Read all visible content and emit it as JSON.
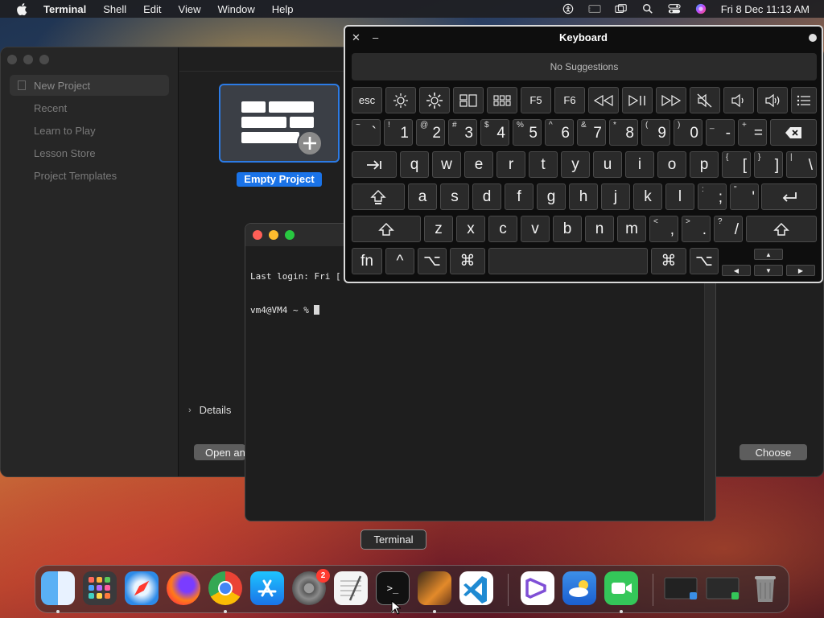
{
  "menubar": {
    "app_name": "Terminal",
    "menus": [
      "Shell",
      "Edit",
      "View",
      "Window",
      "Help"
    ],
    "clock": "Fri 8 Dec  11:13 AM"
  },
  "xcode_window": {
    "sidebar_items": [
      "New Project",
      "Recent",
      "Learn to Play",
      "Lesson Store",
      "Project Templates"
    ],
    "selected_template": "Empty Project",
    "details_label": "Details",
    "open_button": "Open an",
    "choose_button": "Choose"
  },
  "terminal": {
    "line1": "Last login: Fri [",
    "prompt": "vm4@VM4 ~ % "
  },
  "keyboard_viewer": {
    "title": "Keyboard",
    "suggestions": "No Suggestions",
    "fn_row": [
      "esc",
      "F5",
      "F6"
    ],
    "number_row": [
      {
        "shift": "~",
        "main": "`"
      },
      {
        "shift": "!",
        "main": "1"
      },
      {
        "shift": "@",
        "main": "2"
      },
      {
        "shift": "#",
        "main": "3"
      },
      {
        "shift": "$",
        "main": "4"
      },
      {
        "shift": "%",
        "main": "5"
      },
      {
        "shift": "^",
        "main": "6"
      },
      {
        "shift": "&",
        "main": "7"
      },
      {
        "shift": "*",
        "main": "8"
      },
      {
        "shift": "(",
        "main": "9"
      },
      {
        "shift": ")",
        "main": "0"
      },
      {
        "shift": "_",
        "main": "-"
      },
      {
        "shift": "+",
        "main": "="
      }
    ],
    "row_q": [
      "q",
      "w",
      "e",
      "r",
      "t",
      "y",
      "u",
      "i",
      "o",
      "p"
    ],
    "row_q_extra": [
      {
        "shift": "{",
        "main": "["
      },
      {
        "shift": "}",
        "main": "]"
      },
      {
        "shift": "|",
        "main": "\\"
      }
    ],
    "row_a": [
      "a",
      "s",
      "d",
      "f",
      "g",
      "h",
      "j",
      "k",
      "l"
    ],
    "row_a_extra": [
      {
        "shift": ":",
        "main": ";"
      },
      {
        "shift": "\"",
        "main": "'"
      }
    ],
    "row_z": [
      "z",
      "x",
      "c",
      "v",
      "b",
      "n",
      "m"
    ],
    "row_z_extra": [
      {
        "shift": "<",
        "main": ","
      },
      {
        "shift": ">",
        "main": "."
      },
      {
        "shift": "?",
        "main": "/"
      }
    ],
    "bottom": {
      "fn": "fn",
      "ctrl": "^",
      "opt": "⌥",
      "cmd": "⌘"
    }
  },
  "dock": {
    "tooltip": "Terminal",
    "settings_badge": "2",
    "terminal_glyph": ">_"
  },
  "colors": {
    "accent": "#1a73e8",
    "badge": "#ff3b30"
  }
}
